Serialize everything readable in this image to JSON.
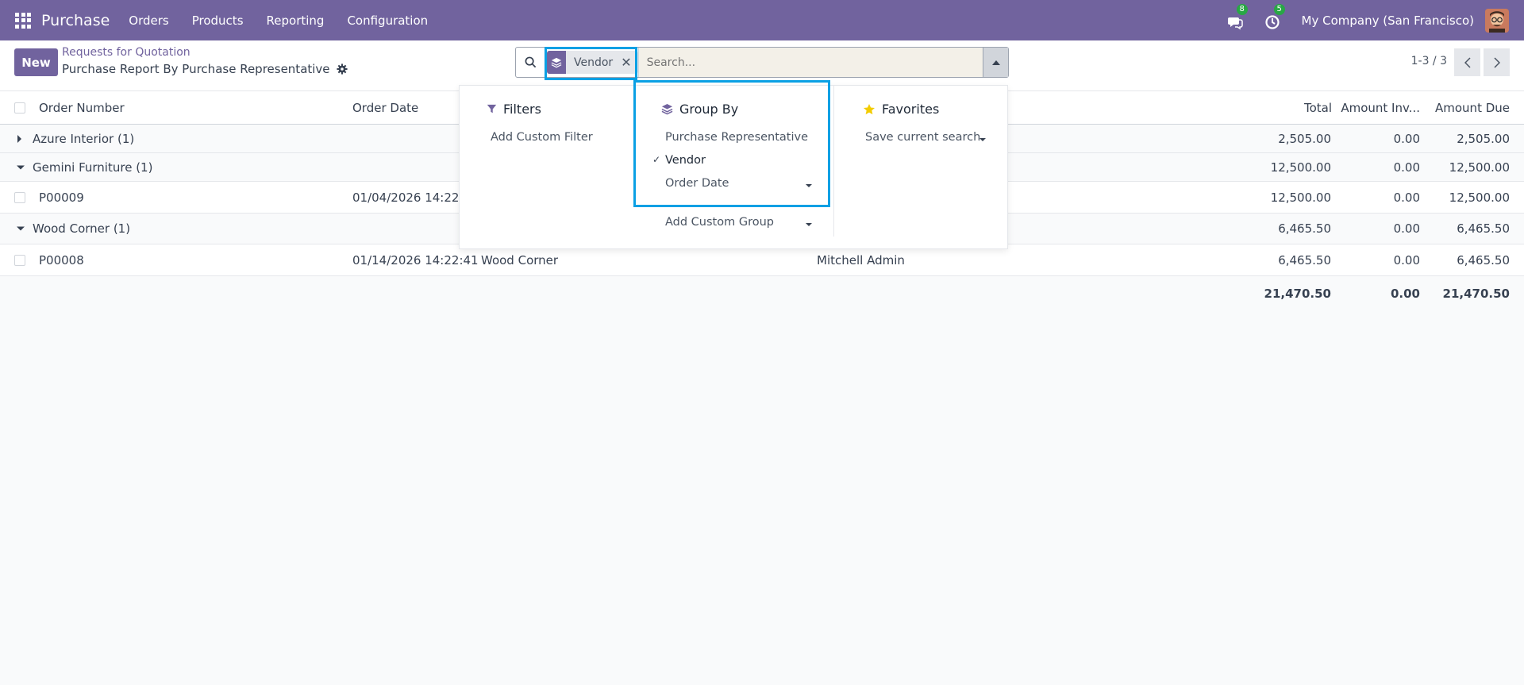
{
  "navbar": {
    "brand": "Purchase",
    "menus": [
      "Orders",
      "Products",
      "Reporting",
      "Configuration"
    ],
    "messages_badge": "8",
    "activities_badge": "5",
    "company": "My Company (San Francisco)",
    "bg_color": "#71639e"
  },
  "control": {
    "new_label": "New",
    "breadcrumb": "Requests for Quotation",
    "subtitle": "Purchase Report By Purchase Representative",
    "facet_label": "Vendor",
    "facet_close": "✕",
    "search_placeholder": "Search...",
    "pager": "1-3 / 3"
  },
  "table": {
    "headers": {
      "order_number": "Order Number",
      "order_date": "Order Date",
      "total": "Total",
      "amount_invoiced": "Amount Inv...",
      "amount_due": "Amount Due"
    },
    "groups": [
      {
        "label": "Azure Interior (1)",
        "total": "2,505.00",
        "invoiced": "0.00",
        "due": "2,505.00"
      },
      {
        "label": "Gemini Furniture (1)",
        "total": "12,500.00",
        "invoiced": "0.00",
        "due": "12,500.00"
      },
      {
        "label": "Wood Corner (1)",
        "total": "6,465.50",
        "invoiced": "0.00",
        "due": "6,465.50"
      }
    ],
    "records": [
      {
        "number": "P00009",
        "date": "01/04/2026 14:22:4",
        "vendor": "",
        "rep": "",
        "total": "12,500.00",
        "invoiced": "0.00",
        "due": "12,500.00"
      },
      {
        "number": "P00008",
        "date": "01/14/2026 14:22:41",
        "vendor": "Wood Corner",
        "rep": "Mitchell Admin",
        "total": "6,465.50",
        "invoiced": "0.00",
        "due": "6,465.50"
      }
    ],
    "totals": {
      "total": "21,470.50",
      "invoiced": "0.00",
      "due": "21,470.50"
    }
  },
  "dropdown": {
    "filters": {
      "title": "Filters",
      "add_custom": "Add Custom Filter"
    },
    "group_by": {
      "title": "Group By",
      "options": [
        "Purchase Representative",
        "Vendor",
        "Order Date"
      ],
      "active": "Vendor",
      "checkmark": "✓",
      "add_custom": "Add Custom Group"
    },
    "favorites": {
      "title": "Favorites",
      "save": "Save current search"
    }
  },
  "colors": {
    "accent": "#71639e",
    "highlight": "#0aa0e4",
    "star": "#f3cc00",
    "badge": "#28a745"
  }
}
